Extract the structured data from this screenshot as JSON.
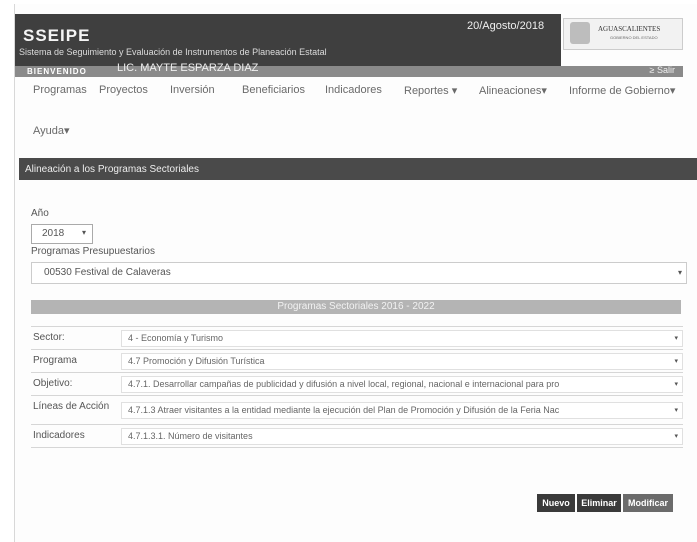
{
  "app": {
    "title": "SSEIPE",
    "subtitle": "Sistema de Seguimiento y Evaluación de Instrumentos de Planeación Estatal",
    "date": "20/Agosto/2018",
    "logo_text": "AGUASCALIENTES",
    "logo_sub": "GOBIERNO DEL ESTADO"
  },
  "welcome_bar": {
    "welcome": "BIENVENIDO",
    "user": "LIC. MAYTE ESPARZA DIAZ",
    "logout": "≥ Salir"
  },
  "nav": {
    "items": [
      "Programas",
      "Proyectos",
      "Inversión",
      "Beneficiarios",
      "Indicadores",
      "Reportes ▾",
      "Alineaciones▾",
      "Informe de Gobierno▾",
      "Ayuda▾"
    ]
  },
  "section": {
    "title": "Alineación a los Programas Sectoriales",
    "year_label": "Año",
    "year_value": "2018",
    "programs_label": "Programas Presupuestarios",
    "program_value": "00530 Festival de Calaveras",
    "band_title": "Programas Sectoriales 2016 - 2022"
  },
  "form": {
    "rows": [
      {
        "label": "Sector:",
        "value": "4 - Economía y Turismo"
      },
      {
        "label": "Programa",
        "value": "4.7 Promoción y Difusión Turística"
      },
      {
        "label": "Objetivo:",
        "value": "4.7.1. Desarrollar campañas de publicidad y difusión a nivel local, regional, nacional e internacional para pro"
      },
      {
        "label": "Líneas de Acción",
        "value": "4.7.1.3 Atraer visitantes a la entidad mediante la ejecución del Plan de Promoción y Difusión de la Feria Nac"
      },
      {
        "label": "Indicadores",
        "value": "4.7.1.3.1. Número de visitantes"
      }
    ]
  },
  "buttons": {
    "new": "Nuevo",
    "delete": "Eliminar",
    "modify": "Modificar"
  },
  "icons": {
    "dropdown": "▾"
  }
}
